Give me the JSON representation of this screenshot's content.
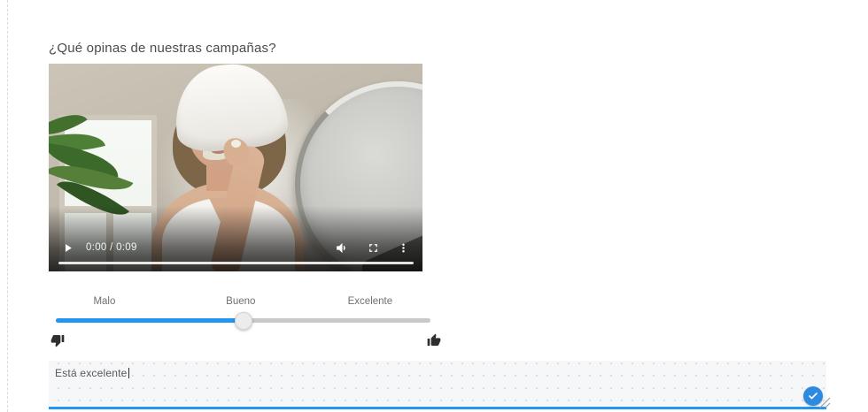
{
  "question": {
    "title": "¿Qué opinas de nuestras campañas?"
  },
  "video_player": {
    "time_display": "0:00 / 0:09",
    "current_time": "0:00",
    "duration": "0:09",
    "icons": {
      "play": "play-icon",
      "volume": "volume-icon",
      "fullscreen": "fullscreen-icon",
      "more": "more-options-icon"
    }
  },
  "rating_slider": {
    "labels": [
      "Malo",
      "Bueno",
      "Excelente"
    ],
    "selected": "Bueno",
    "fill_percent": 50,
    "min_icon": "thumbs-down-icon",
    "max_icon": "thumbs-up-icon"
  },
  "comment_box": {
    "value": "Está excelente",
    "submit_icon": "check-icon"
  },
  "colors": {
    "accent_blue": "#2196f3",
    "submit_blue": "#2e89e0",
    "track_gray": "#c9c9c9",
    "title_text": "#4b4b4b",
    "label_text": "#6f6f6f"
  }
}
